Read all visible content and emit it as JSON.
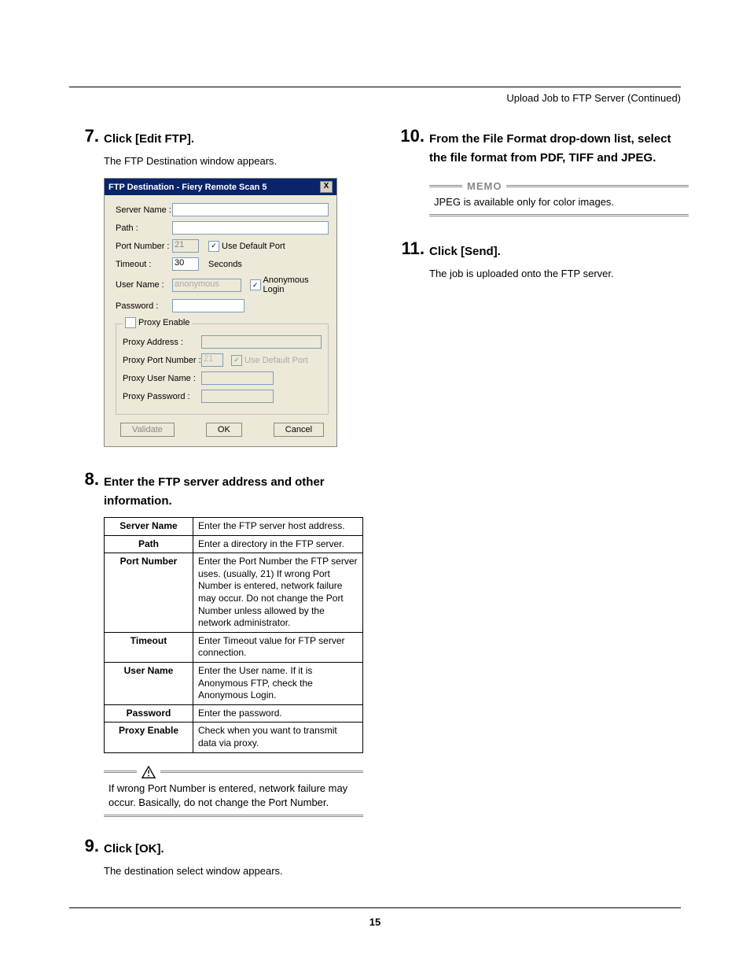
{
  "header": "Upload Job to FTP Server (Continued)",
  "page_number": "15",
  "steps": {
    "s7": {
      "num": "7",
      "title": "Click [Edit FTP].",
      "body": "The FTP Destination window appears."
    },
    "s8": {
      "num": "8",
      "title": "Enter the FTP server address and other information."
    },
    "s9": {
      "num": "9",
      "title": "Click [OK].",
      "body": "The destination select window appears."
    },
    "s10": {
      "num": "10",
      "title": "From the File Format drop-down list, select the file format from PDF, TIFF and JPEG."
    },
    "s11": {
      "num": "11",
      "title": "Click [Send].",
      "body": "The job is uploaded onto the FTP server."
    }
  },
  "dialog": {
    "title": "FTP Destination - Fiery Remote Scan 5",
    "close": "X",
    "labels": {
      "server": "Server Name :",
      "path": "Path :",
      "port": "Port Number :",
      "timeout": "Timeout :",
      "user": "User Name :",
      "password": "Password :",
      "use_default": "Use Default Port",
      "seconds": "Seconds",
      "anon": "Anonymous Login",
      "proxy_enable": "Proxy Enable",
      "proxy_addr": "Proxy Address :",
      "proxy_port": "Proxy Port Number :",
      "proxy_use_default": "Use Default Port",
      "proxy_user": "Proxy User Name :",
      "proxy_pass": "Proxy Password :"
    },
    "values": {
      "port": "21",
      "timeout": "30",
      "user": "anonymous",
      "proxy_port": "21"
    },
    "buttons": {
      "validate": "Validate",
      "ok": "OK",
      "cancel": "Cancel"
    }
  },
  "table": {
    "rows": [
      {
        "k": "Server Name",
        "v": "Enter the FTP server host address."
      },
      {
        "k": "Path",
        "v": "Enter a directory in the FTP server."
      },
      {
        "k": "Port Number",
        "v": "Enter the Port Number the FTP server uses. (usually, 21)  If wrong Port Number is entered, network failure may occur.  Do not change the Port Number unless allowed by the network administrator."
      },
      {
        "k": "Timeout",
        "v": "Enter Timeout value for FTP server connection."
      },
      {
        "k": "User Name",
        "v": "Enter the User name.  If it is Anonymous FTP, check the Anonymous Login."
      },
      {
        "k": "Password",
        "v": "Enter the password."
      },
      {
        "k": "Proxy Enable",
        "v": "Check when you want to transmit data via proxy."
      }
    ]
  },
  "warning": "If wrong Port Number is entered, network failure may occur.  Basically, do not change the Port Number.",
  "memo": {
    "label": "MEMO",
    "body": "JPEG is available only for color images."
  }
}
